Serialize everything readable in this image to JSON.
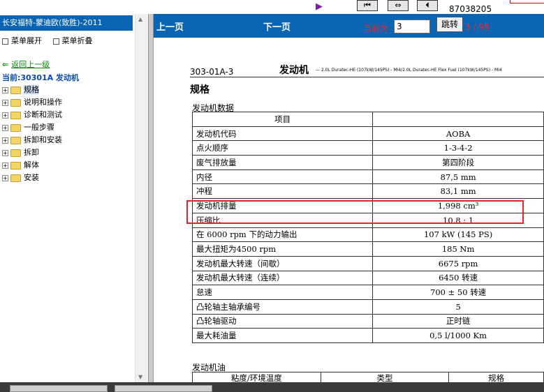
{
  "top": {
    "code": "87038205"
  },
  "left": {
    "model_title": "长安福特-蒙迪欧(致胜)-2011",
    "menu_expand": "菜单展开",
    "menu_collapse": "菜单折叠",
    "back": "返回上一级",
    "current_node": "当前:30301A 发动机",
    "tree": [
      {
        "label": "规格",
        "selected": true
      },
      {
        "label": "说明和操作"
      },
      {
        "label": "诊断和测试"
      },
      {
        "label": "一般步骤"
      },
      {
        "label": "拆卸和安装"
      },
      {
        "label": "拆卸"
      },
      {
        "label": "解体"
      },
      {
        "label": "安装"
      }
    ]
  },
  "nav": {
    "prev": "上一页",
    "next": "下一页",
    "current_label": "当前为",
    "page_value": "3",
    "jump": "跳转",
    "page_count": "3 / 98"
  },
  "doc": {
    "code": "303-01A-3",
    "chapter": "发动机",
    "variant": "— 2.0L Duratec-HE (107kW/145PS) - MI4/2.0L Duratec-HE Flex Fuel (107kW/145PS) - MI4",
    "section_title": "规格",
    "engine_data_title": "发动机数据",
    "table_header": "项目",
    "rows": [
      {
        "item": "发动机代码",
        "value": "AOBA"
      },
      {
        "item": "点火顺序",
        "value": "1-3-4-2"
      },
      {
        "item": "废气排放量",
        "value": "第四阶段"
      },
      {
        "item": "内径",
        "value": "87,5 mm"
      },
      {
        "item": "冲程",
        "value": "83,1 mm"
      },
      {
        "item": "发动机排量",
        "value": "1,998 cm³"
      },
      {
        "item": "压缩比",
        "value": "10,8 : 1"
      },
      {
        "item": "在 6000 rpm 下的动力输出",
        "value": "107 kW (145 PS)"
      },
      {
        "item": "最大扭矩为4500 rpm",
        "value": "185 Nm"
      },
      {
        "item": "发动机最大转速（间歇）",
        "value": "6675 rpm"
      },
      {
        "item": "发动机最大转速（连续）",
        "value": "6450 转速"
      },
      {
        "item": "怠速",
        "value": "700 ± 50 转速"
      },
      {
        "item": "凸轮轴主轴承编号",
        "value": "5"
      },
      {
        "item": "凸轮轴驱动",
        "value": "正时链"
      },
      {
        "item": "最大耗油量",
        "value": "0,5 l/1000 Km"
      }
    ],
    "oil_title": "发动机油",
    "oil_headers": [
      "粘度/环境温度",
      "类型",
      "规格"
    ]
  }
}
